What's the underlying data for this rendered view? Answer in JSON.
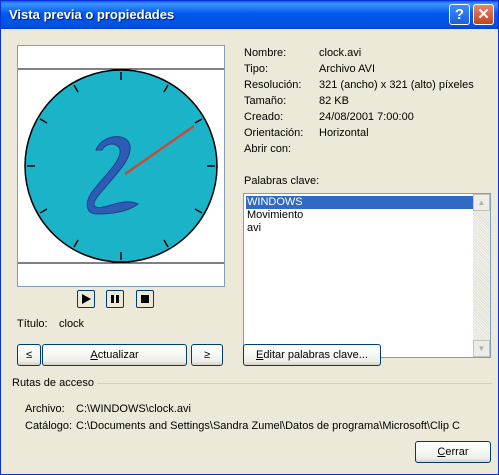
{
  "window": {
    "title": "Vista previa o propiedades",
    "help_label": "?",
    "close_label": "✕"
  },
  "preview": {
    "title_label": "Título:",
    "title_value": "clock",
    "play_icon": "play-icon",
    "pause_icon": "pause-icon",
    "stop_icon": "stop-icon"
  },
  "properties": [
    {
      "name": "Nombre:",
      "value": "clock.avi"
    },
    {
      "name": "Tipo:",
      "value": "Archivo AVI"
    },
    {
      "name": "Resolución:",
      "value": "321 (ancho) x 321 (alto) píxeles"
    },
    {
      "name": "Tamaño:",
      "value": "82 KB"
    },
    {
      "name": "Creado:",
      "value": "24/08/2001 7:00:00"
    },
    {
      "name": "Orientación:",
      "value": "Horizontal"
    },
    {
      "name": "Abrir con:",
      "value": ""
    }
  ],
  "keywords": {
    "label": "Palabras clave:",
    "items": [
      "WINDOWS",
      "Movimiento",
      "avi"
    ],
    "selected_index": 0
  },
  "nav": {
    "prev_label": "≤",
    "update_label": "Actualizar",
    "next_label": "≥",
    "edit_keywords_label": "Editar palabras clave..."
  },
  "paths": {
    "group_label": "Rutas de acceso",
    "file_label": "Archivo:",
    "file_value": "C:\\WINDOWS\\clock.avi",
    "catalog_label": "Catálogo:",
    "catalog_value": "C:\\Documents and Settings\\Sandra Zumel\\Datos de programa\\Microsoft\\Clip C"
  },
  "close_button_label": "Cerrar",
  "colors": {
    "clock_face": "#1AB3C8",
    "hand": "#C84A3A",
    "digit": "#2E5BB5",
    "titlebar": "#0058EE"
  }
}
